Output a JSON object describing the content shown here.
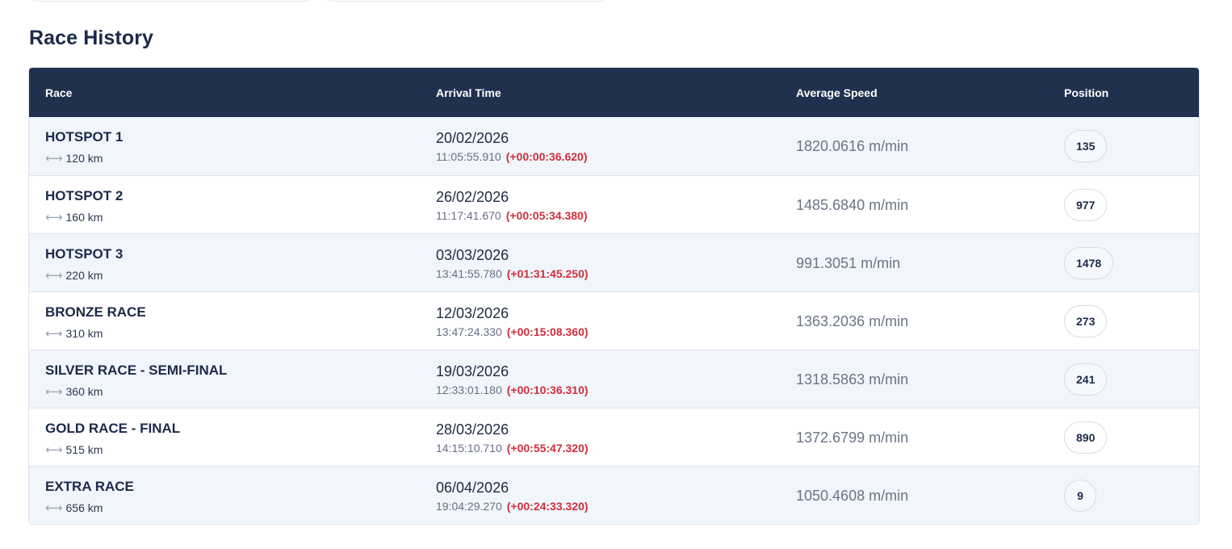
{
  "section": {
    "title": "Race History"
  },
  "table": {
    "headers": {
      "race": "Race",
      "arrival": "Arrival Time",
      "speed": "Average Speed",
      "position": "Position"
    },
    "rows": [
      {
        "race": "HOTSPOT 1",
        "distance": "120 km",
        "date": "20/02/2026",
        "time": "11:05:55.910",
        "delta": "(+00:00:36.620)",
        "speed": "1820.0616 m/min",
        "position": "135"
      },
      {
        "race": "HOTSPOT 2",
        "distance": "160 km",
        "date": "26/02/2026",
        "time": "11:17:41.670",
        "delta": "(+00:05:34.380)",
        "speed": "1485.6840 m/min",
        "position": "977"
      },
      {
        "race": "HOTSPOT 3",
        "distance": "220 km",
        "date": "03/03/2026",
        "time": "13:41:55.780",
        "delta": "(+01:31:45.250)",
        "speed": "991.3051 m/min",
        "position": "1478"
      },
      {
        "race": "BRONZE RACE",
        "distance": "310 km",
        "date": "12/03/2026",
        "time": "13:47:24.330",
        "delta": "(+00:15:08.360)",
        "speed": "1363.2036 m/min",
        "position": "273"
      },
      {
        "race": "SILVER RACE - SEMI-FINAL",
        "distance": "360 km",
        "date": "19/03/2026",
        "time": "12:33:01.180",
        "delta": "(+00:10:36.310)",
        "speed": "1318.5863 m/min",
        "position": "241"
      },
      {
        "race": "GOLD RACE - FINAL",
        "distance": "515 km",
        "date": "28/03/2026",
        "time": "14:15:10.710",
        "delta": "(+00:55:47.320)",
        "speed": "1372.6799 m/min",
        "position": "890"
      },
      {
        "race": "EXTRA RACE",
        "distance": "656 km",
        "date": "06/04/2026",
        "time": "19:04:29.270",
        "delta": "(+00:24:33.320)",
        "speed": "1050.4608 m/min",
        "position": "9"
      }
    ]
  },
  "icons": {
    "distance": "left-right-arrow-icon"
  },
  "colors": {
    "header_bg": "#20314f",
    "delta": "#d12e3b",
    "row_alt": "#f1f5fc"
  }
}
